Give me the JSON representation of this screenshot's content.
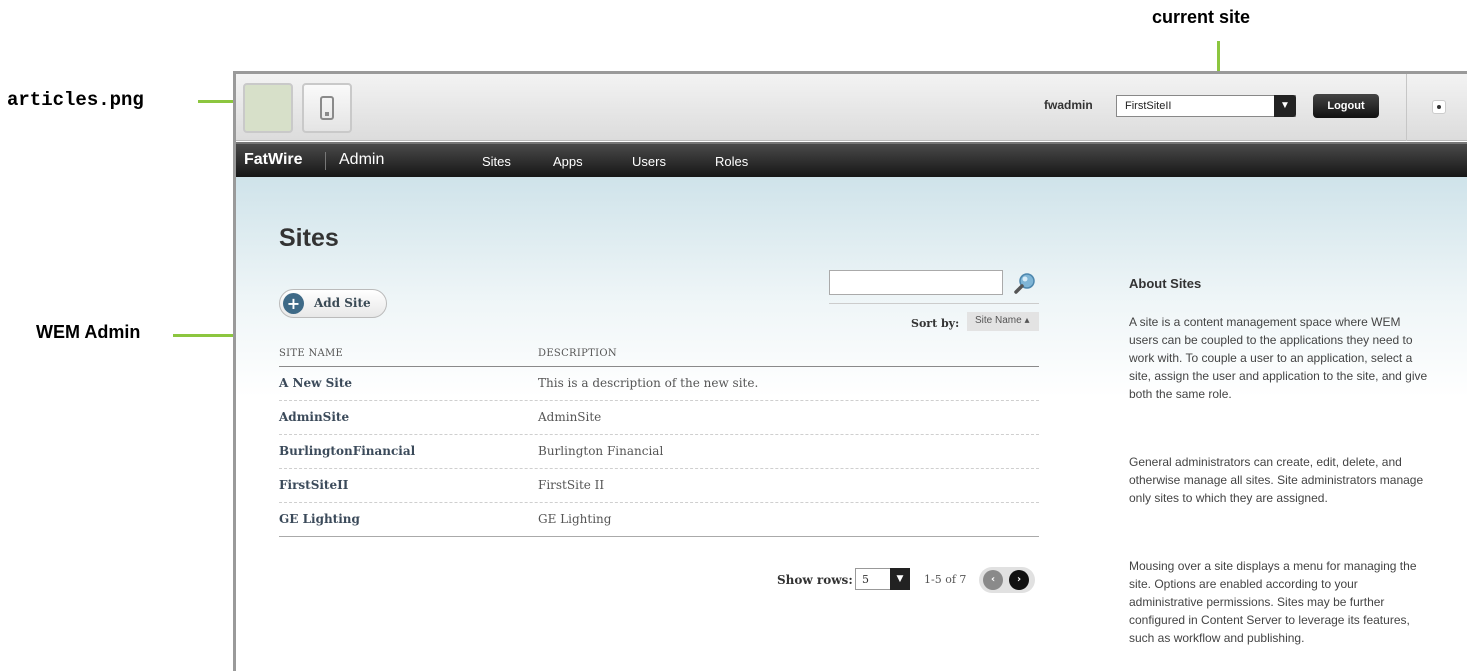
{
  "callouts": {
    "current_site": "current site",
    "articles_png": "articles.png",
    "wem_admin": "WEM Admin"
  },
  "topbar": {
    "username": "fwadmin",
    "site_select_value": "FirstSiteII",
    "logout_label": "Logout"
  },
  "nav": {
    "brand": "FatWire",
    "section": "Admin",
    "items": [
      {
        "label": "Sites"
      },
      {
        "label": "Apps"
      },
      {
        "label": "Users"
      },
      {
        "label": "Roles"
      }
    ]
  },
  "page": {
    "title": "Sites",
    "add_button_label": "Add Site",
    "search_placeholder": "",
    "sort_by_label": "Sort by:",
    "sort_value": "Site Name ▴"
  },
  "table": {
    "headers": {
      "name": "SITE NAME",
      "description": "DESCRIPTION"
    },
    "rows": [
      {
        "name": "A New Site",
        "description": "This is a description of the new site."
      },
      {
        "name": "AdminSite",
        "description": "AdminSite"
      },
      {
        "name": "BurlingtonFinancial",
        "description": "Burlington Financial"
      },
      {
        "name": "FirstSiteII",
        "description": "FirstSite II"
      },
      {
        "name": "GE Lighting",
        "description": "GE Lighting"
      }
    ]
  },
  "pagination": {
    "show_rows_label": "Show rows:",
    "rows_value": "5",
    "range_text": "1-5 of 7"
  },
  "about": {
    "title": "About Sites",
    "paragraphs": [
      "A site is a content management space where WEM users can be coupled to the applications they need to work with. To couple a user to an application, select a site, assign the user and application to the site, and give both the same role.",
      "General administrators can create, edit, delete, and otherwise manage all sites. Site administrators manage only sites to which they are assigned.",
      "Mousing over a site displays a menu for managing the site. Options are enabled according to your administrative permissions. Sites may be further configured in Content Server to leverage its features, such as workflow and publishing."
    ]
  },
  "colors": {
    "callout_line": "#8cc63f",
    "nav_bg": "#1e1e1e",
    "content_gradient_top": "#cfe3ea"
  }
}
